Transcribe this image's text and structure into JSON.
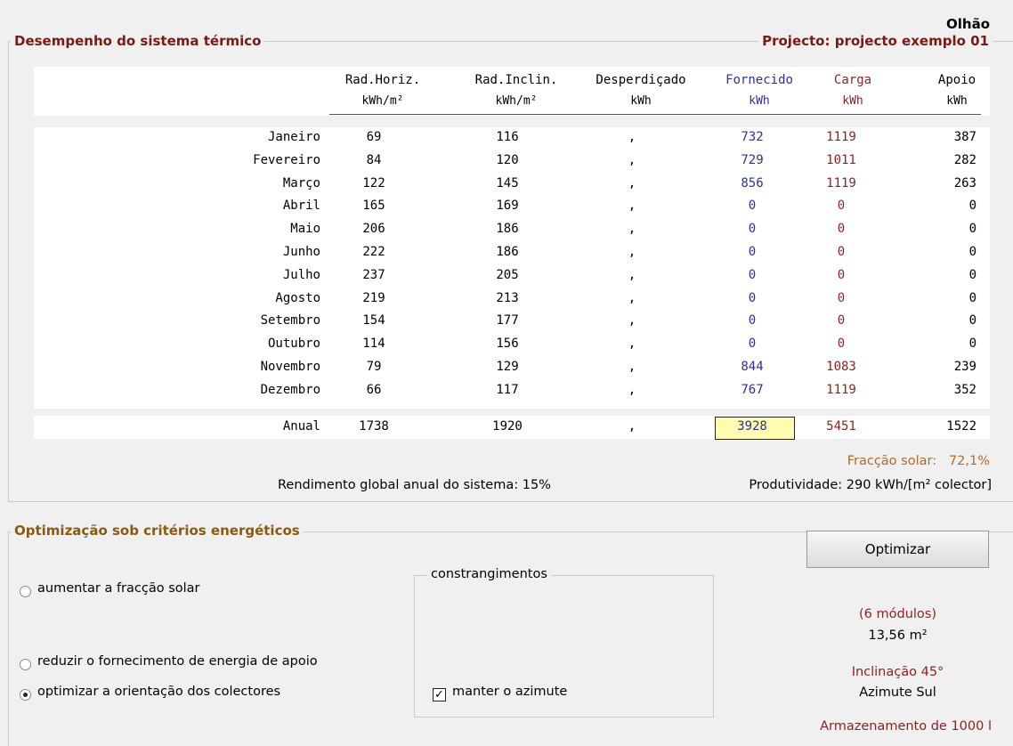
{
  "location": "Olhão",
  "performance": {
    "title": "Desempenho do sistema térmico",
    "project": "Projecto: projecto exemplo 01",
    "columns": [
      {
        "name": "Rad.Horiz.",
        "unit": "kWh/m²"
      },
      {
        "name": "Rad.Inclin.",
        "unit": "kWh/m²"
      },
      {
        "name": "Desperdiçado",
        "unit": "kWh"
      },
      {
        "name": "Fornecido",
        "unit": "kWh"
      },
      {
        "name": "Carga",
        "unit": "kWh"
      },
      {
        "name": "Apoio",
        "unit": "kWh"
      }
    ],
    "rows": [
      {
        "month": "Janeiro",
        "hz": "69",
        "inc": "116",
        "des": ",",
        "forn": "732",
        "carga": "1119",
        "apoio": "387"
      },
      {
        "month": "Fevereiro",
        "hz": "84",
        "inc": "120",
        "des": ",",
        "forn": "729",
        "carga": "1011",
        "apoio": "282"
      },
      {
        "month": "Março",
        "hz": "122",
        "inc": "145",
        "des": ",",
        "forn": "856",
        "carga": "1119",
        "apoio": "263"
      },
      {
        "month": "Abril",
        "hz": "165",
        "inc": "169",
        "des": ",",
        "forn": "0",
        "carga": "0",
        "apoio": "0"
      },
      {
        "month": "Maio",
        "hz": "206",
        "inc": "186",
        "des": ",",
        "forn": "0",
        "carga": "0",
        "apoio": "0"
      },
      {
        "month": "Junho",
        "hz": "222",
        "inc": "186",
        "des": ",",
        "forn": "0",
        "carga": "0",
        "apoio": "0"
      },
      {
        "month": "Julho",
        "hz": "237",
        "inc": "205",
        "des": ",",
        "forn": "0",
        "carga": "0",
        "apoio": "0"
      },
      {
        "month": "Agosto",
        "hz": "219",
        "inc": "213",
        "des": ",",
        "forn": "0",
        "carga": "0",
        "apoio": "0"
      },
      {
        "month": "Setembro",
        "hz": "154",
        "inc": "177",
        "des": ",",
        "forn": "0",
        "carga": "0",
        "apoio": "0"
      },
      {
        "month": "Outubro",
        "hz": "114",
        "inc": "156",
        "des": ",",
        "forn": "0",
        "carga": "0",
        "apoio": "0"
      },
      {
        "month": "Novembro",
        "hz": "79",
        "inc": "129",
        "des": ",",
        "forn": "844",
        "carga": "1083",
        "apoio": "239"
      },
      {
        "month": "Dezembro",
        "hz": "66",
        "inc": "117",
        "des": ",",
        "forn": "767",
        "carga": "1119",
        "apoio": "352"
      }
    ],
    "annual": {
      "month": "Anual",
      "hz": "1738",
      "inc": "1920",
      "des": ",",
      "forn": "3928",
      "carga": "5451",
      "apoio": "1522"
    },
    "solar_fraction_label": "Fracção solar:",
    "solar_fraction_value": "72,1%",
    "global_yield": "Rendimento global anual do sistema: 15%",
    "productivity": "Produtividade: 290 kWh/[m² colector]"
  },
  "optimization": {
    "title": "Optimização sob critérios energéticos",
    "options": [
      {
        "label": "aumentar a fracção solar",
        "selected": false
      },
      {
        "label": "reduzir o fornecimento de energia de apoio",
        "selected": false
      },
      {
        "label": "optimizar a orientação dos colectores",
        "selected": true
      }
    ],
    "constraints_title": "constrangimentos",
    "constraint_checkbox_label": "manter o azimute",
    "constraint_checked": true,
    "button_label": "Optimizar",
    "modules": "(6 módulos)",
    "area": "13,56 m²",
    "inclination": "Inclinação 45°",
    "azimuth": "Azimute Sul",
    "storage": "Armazenamento de 1000 l"
  }
}
